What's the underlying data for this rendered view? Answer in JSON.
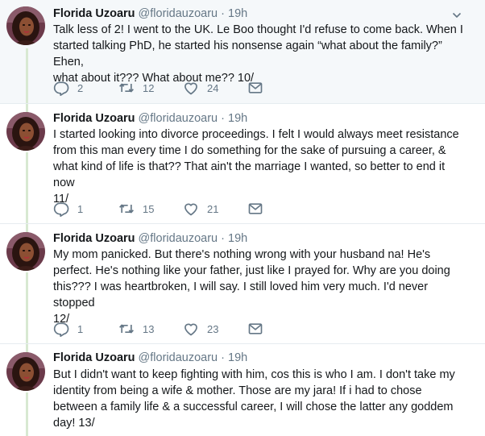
{
  "tweets": [
    {
      "name": "Florida Uzoaru",
      "handle": "@floridauzoaru",
      "sep": "·",
      "time": "19h",
      "lines": [
        "Talk less of 2! I went to the UK. Le Boo thought I'd refuse to come back. When I",
        "started talking PhD, he started his nonsense again “what about the family?” Ehen,",
        "what about it??? What about me?? 10/"
      ],
      "replies": "2",
      "retweets": "12",
      "likes": "24"
    },
    {
      "name": "Florida Uzoaru",
      "handle": "@floridauzoaru",
      "sep": "·",
      "time": "19h",
      "lines": [
        "I started looking into divorce proceedings. I felt I would always meet resistance",
        "from this man every time I do something for the sake of pursuing a career, &",
        "what kind of life is that?? That ain't the marriage I wanted, so better to end it now",
        "11/"
      ],
      "replies": "1",
      "retweets": "15",
      "likes": "21"
    },
    {
      "name": "Florida Uzoaru",
      "handle": "@floridauzoaru",
      "sep": "·",
      "time": "19h",
      "lines": [
        "My mom panicked. But there's nothing wrong with your husband na! He's",
        "perfect. He's nothing like your father, just like I prayed for. Why are you doing",
        "this??? I was heartbroken, I will say. I still loved him very much. I'd never stopped",
        "12/"
      ],
      "replies": "1",
      "retweets": "13",
      "likes": "23"
    },
    {
      "name": "Florida Uzoaru",
      "handle": "@floridauzoaru",
      "sep": "·",
      "time": "19h",
      "lines": [
        "But I didn't want to keep fighting with him, cos this is who I am. I don't take my",
        "identity from being a wife & mother. Those are my jara! If i had to chose",
        "between a family life & a successful career, I will chose the latter any goddem",
        "day! 13/"
      ]
    }
  ],
  "colors": {
    "thread_line": "#d8e9d2",
    "highlight_bg": "#f5f8fa",
    "secondary_text": "#657786",
    "icon": "#657786"
  },
  "icons": [
    "reply-icon",
    "retweet-icon",
    "like-icon",
    "message-icon",
    "chevron-down-icon"
  ]
}
